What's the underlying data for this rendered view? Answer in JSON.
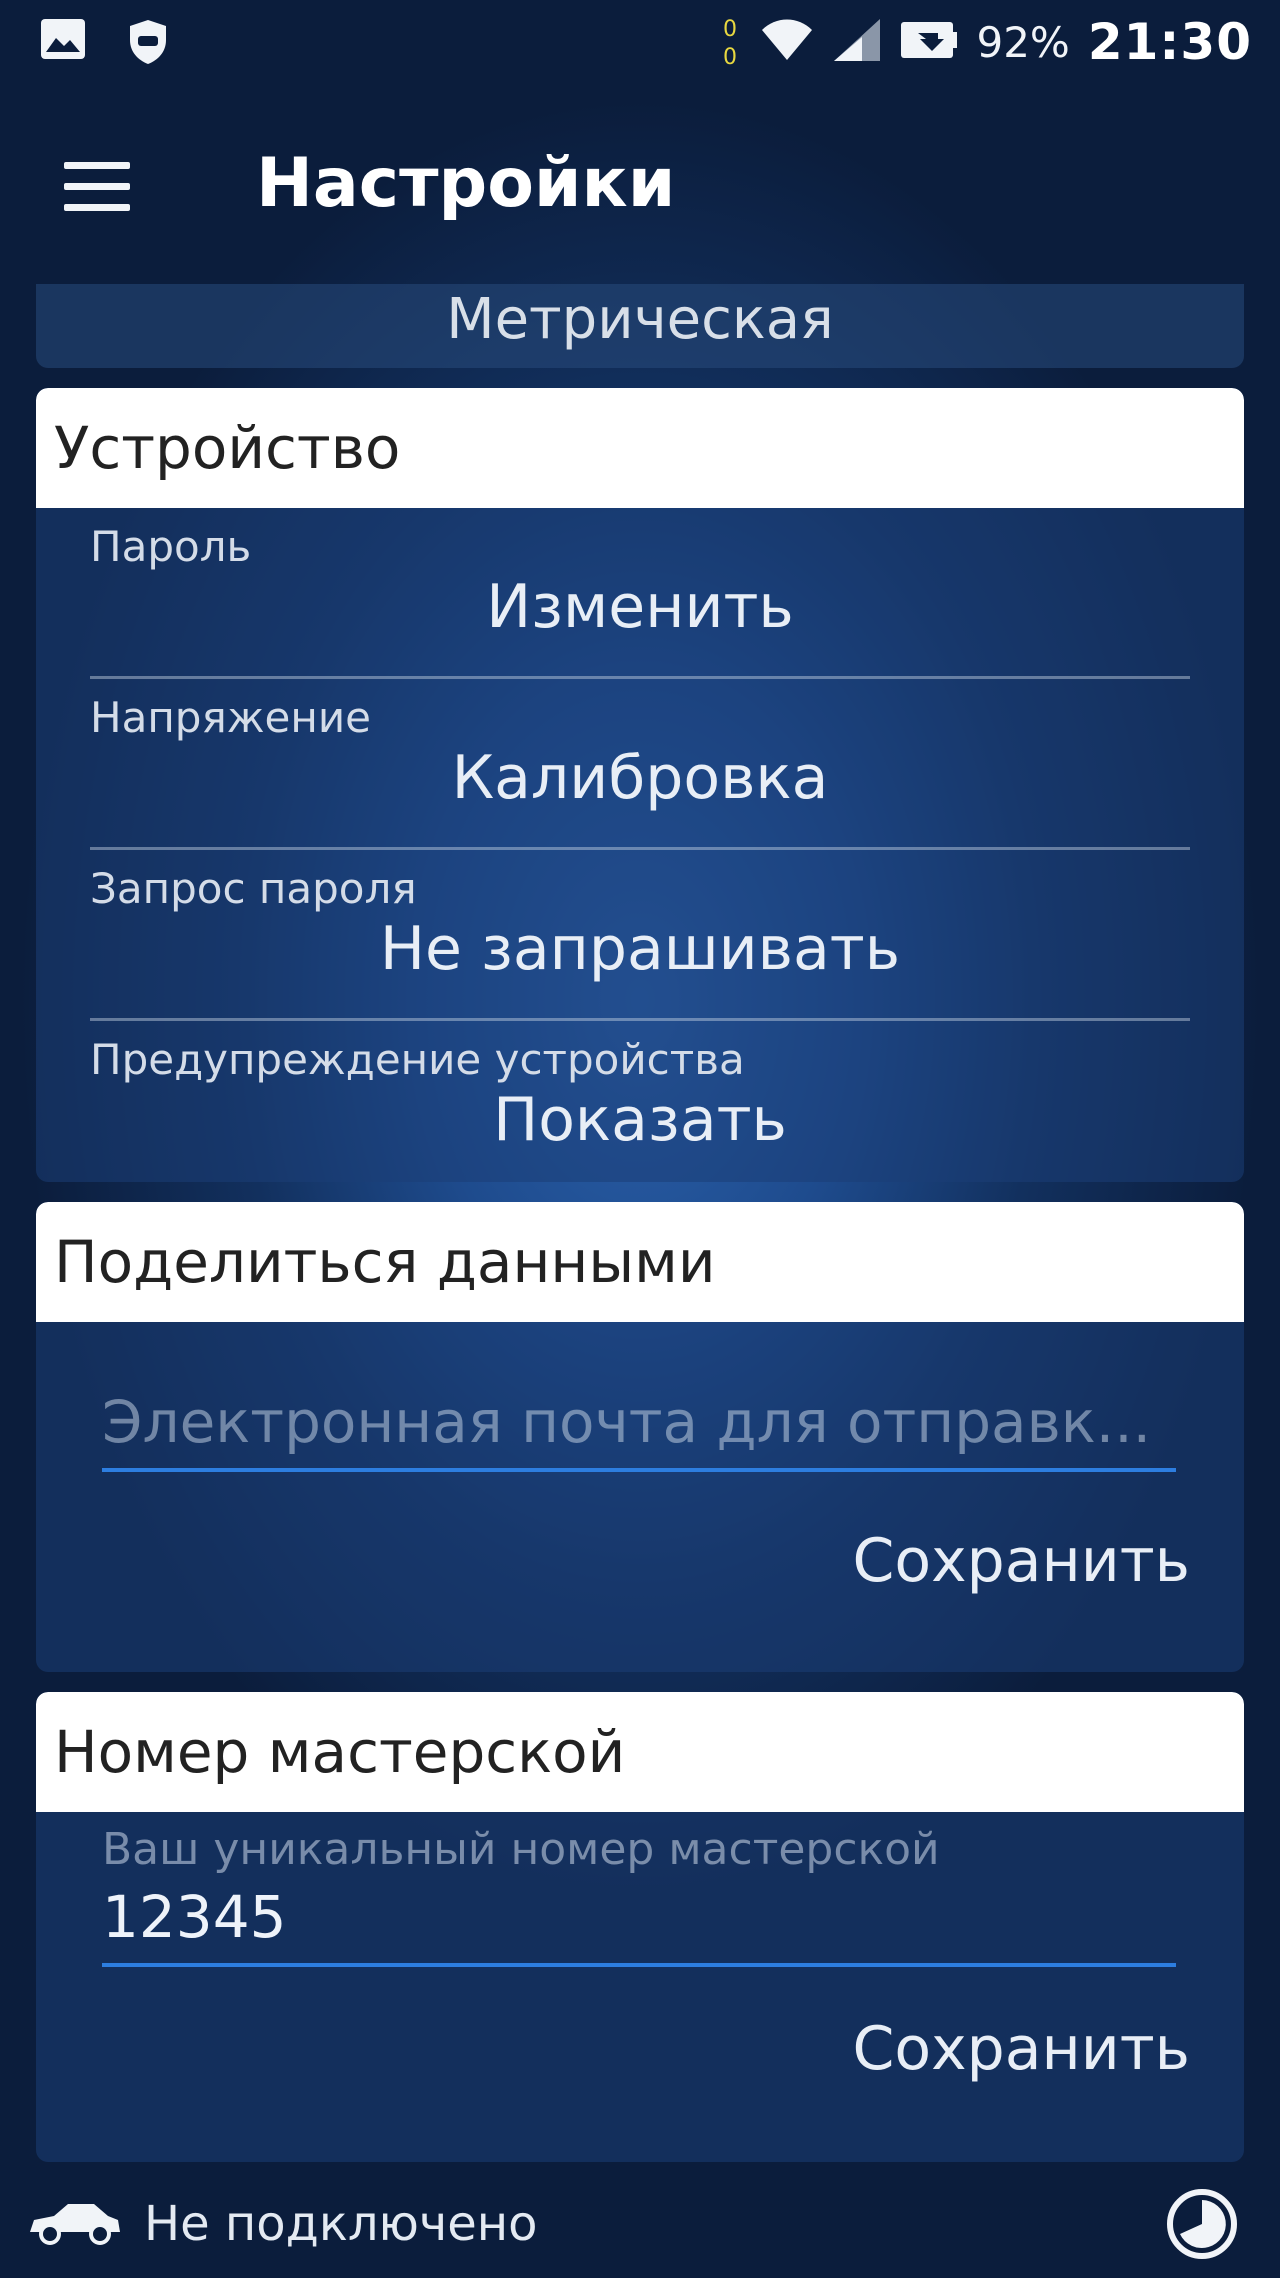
{
  "status_bar": {
    "battery": "92%",
    "time": "21:30",
    "icons": [
      "image-icon",
      "shield-icon",
      "data-arrows-icon",
      "wifi-icon",
      "signal-icon",
      "battery-icon"
    ]
  },
  "app_bar": {
    "title": "Настройки",
    "menu_icon": "menu-icon"
  },
  "units": {
    "value": "Метрическая"
  },
  "device": {
    "header": "Устройство",
    "settings": [
      {
        "label": "Пароль",
        "value": "Изменить"
      },
      {
        "label": "Напряжение",
        "value": "Калибровка"
      },
      {
        "label": "Запрос пароля",
        "value": "Не запрашивать"
      },
      {
        "label": "Предупреждение устройства",
        "value": "Показать"
      }
    ]
  },
  "share": {
    "header": "Поделиться данными",
    "email_placeholder": "Электронная почта для отправк...",
    "email_value": "",
    "save_label": "Сохранить"
  },
  "workshop": {
    "header": "Номер мастерской",
    "hint": "Ваш уникальный номер мастерской",
    "value": "12345",
    "save_label": "Сохранить"
  },
  "bottom_bar": {
    "status": "Не подключено",
    "icons": [
      "car-icon",
      "refresh-icon"
    ]
  },
  "colors": {
    "accent_underline": "#2d7ee0",
    "header_bg": "#ffffff",
    "background_dark": "#0b1d3c",
    "background_glow": "#2c63ae"
  }
}
